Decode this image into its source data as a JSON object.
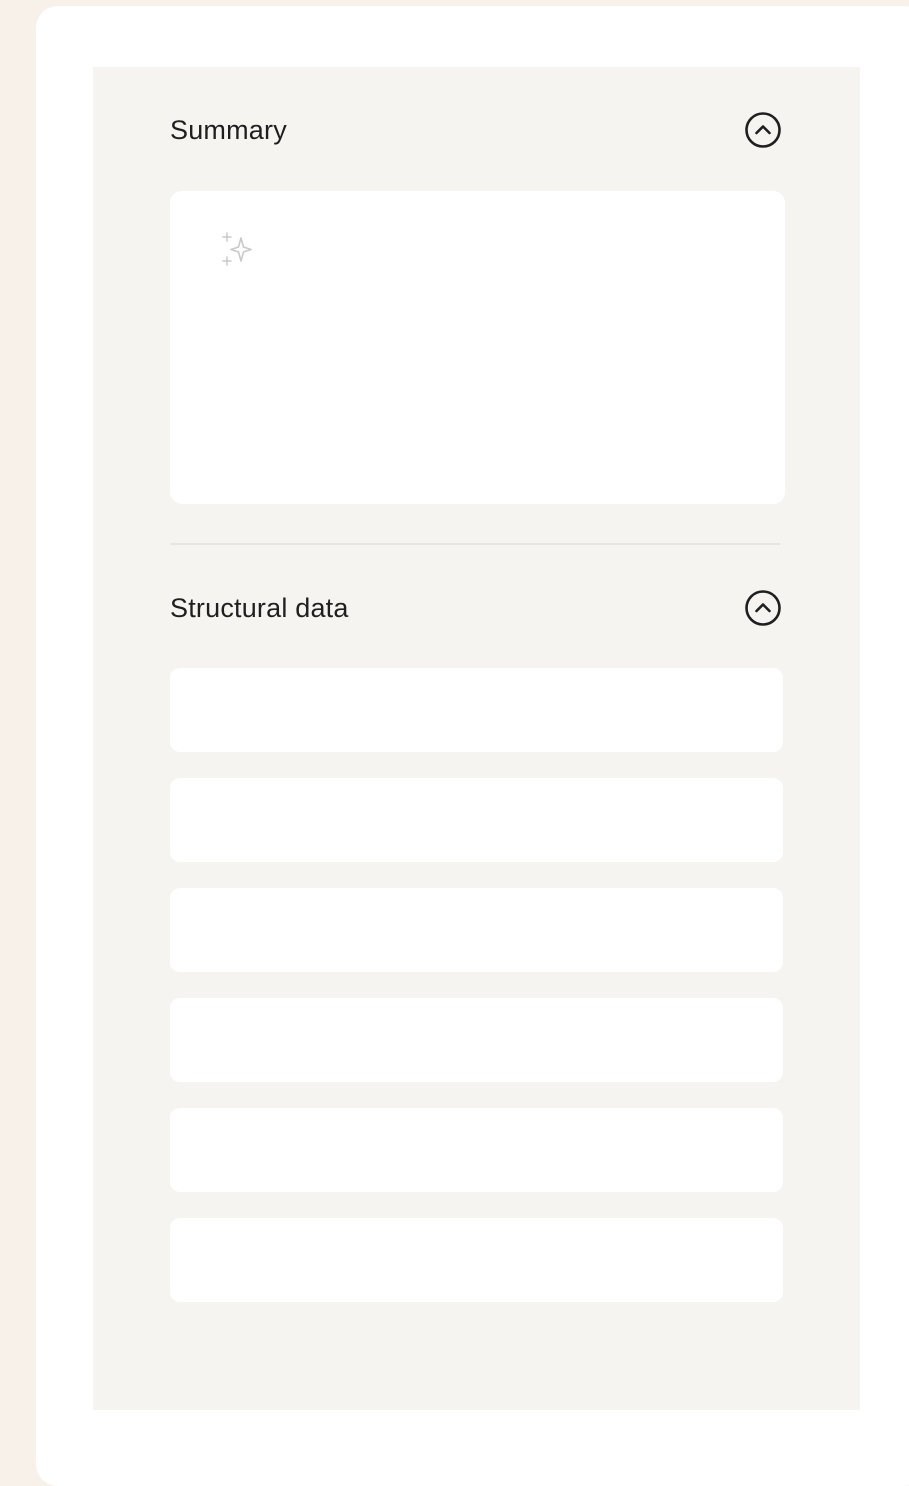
{
  "summary": {
    "title": "Summary",
    "collapse_icon": "chevron-up-circle-icon",
    "content_icon": "sparkle-icon",
    "text": ""
  },
  "structural_data": {
    "title": "Structural data",
    "collapse_icon": "chevron-up-circle-icon",
    "rows": [
      "",
      "",
      "",
      "",
      "",
      ""
    ]
  },
  "colors": {
    "page_background": "#f8f1ea",
    "panel_background": "#f5f4f1",
    "card_background": "#ffffff",
    "text_primary": "#1f1f1f",
    "icon_muted": "#c9c9c9"
  }
}
